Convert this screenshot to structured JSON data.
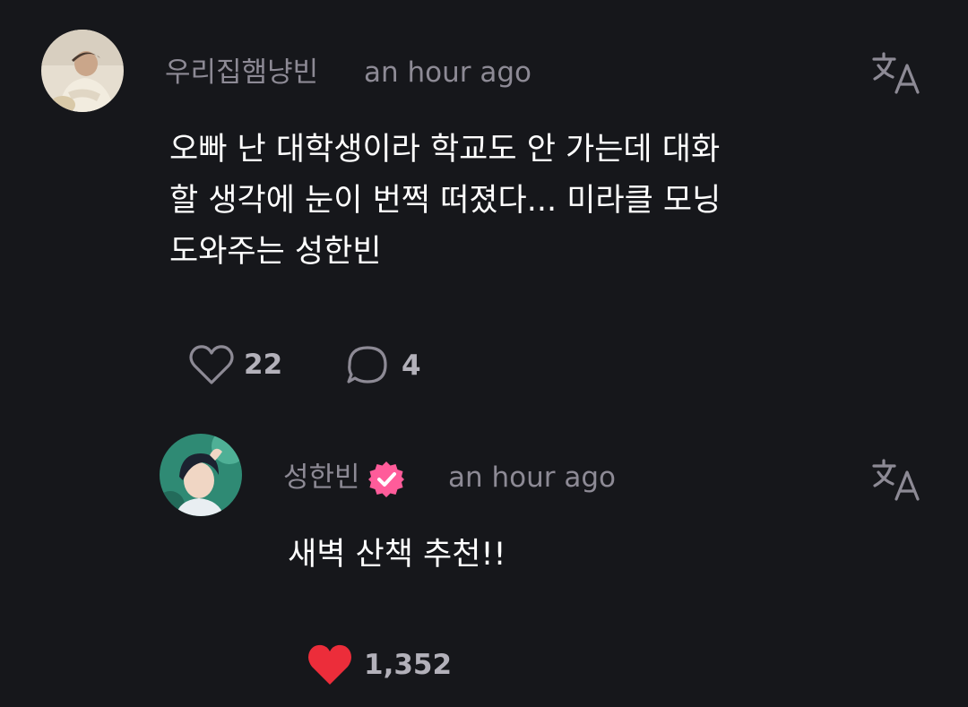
{
  "comment": {
    "author": "우리집햄냥빈",
    "time": "an hour ago",
    "body": "오빠 난 대학생이라 학교도 안 가는데 대화\n할 생각에 눈이 번쩍 떠졌다... 미라클 모닝\n도와주는 성한빈",
    "like_count": "22",
    "reply_count": "4",
    "translate_icon": "translate-icon",
    "colors": {
      "background": "#16171b",
      "meta_text": "#8d8a95",
      "count_text": "#b3b1ba"
    }
  },
  "reply": {
    "author": "성한빈",
    "verified": true,
    "time": "an hour ago",
    "body": "새벽 산책 추천!!",
    "like_count": "1,352",
    "liked": true,
    "translate_icon": "translate-icon",
    "colors": {
      "verified_badge": "#ff5c9a",
      "liked_heart": "#ec2d3a"
    }
  }
}
